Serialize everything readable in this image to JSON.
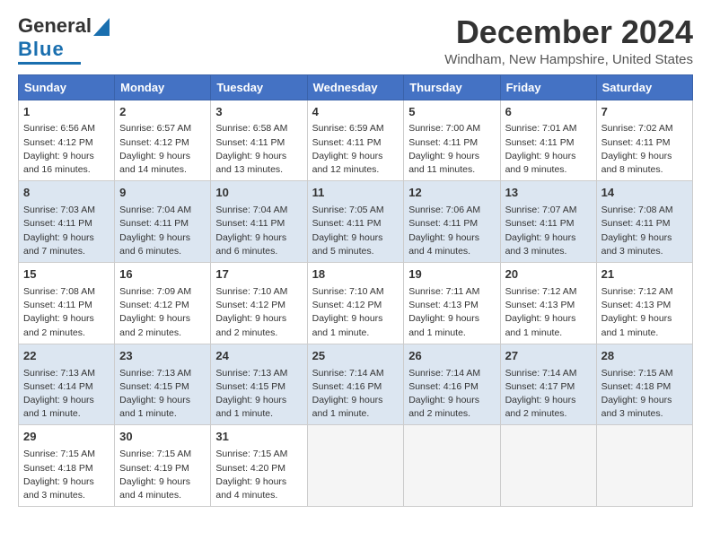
{
  "header": {
    "logo_line1": "General",
    "logo_line2": "Blue",
    "month": "December 2024",
    "location": "Windham, New Hampshire, United States"
  },
  "weekdays": [
    "Sunday",
    "Monday",
    "Tuesday",
    "Wednesday",
    "Thursday",
    "Friday",
    "Saturday"
  ],
  "weeks": [
    [
      {
        "day": 1,
        "info": "Sunrise: 6:56 AM\nSunset: 4:12 PM\nDaylight: 9 hours\nand 16 minutes."
      },
      {
        "day": 2,
        "info": "Sunrise: 6:57 AM\nSunset: 4:12 PM\nDaylight: 9 hours\nand 14 minutes."
      },
      {
        "day": 3,
        "info": "Sunrise: 6:58 AM\nSunset: 4:11 PM\nDaylight: 9 hours\nand 13 minutes."
      },
      {
        "day": 4,
        "info": "Sunrise: 6:59 AM\nSunset: 4:11 PM\nDaylight: 9 hours\nand 12 minutes."
      },
      {
        "day": 5,
        "info": "Sunrise: 7:00 AM\nSunset: 4:11 PM\nDaylight: 9 hours\nand 11 minutes."
      },
      {
        "day": 6,
        "info": "Sunrise: 7:01 AM\nSunset: 4:11 PM\nDaylight: 9 hours\nand 9 minutes."
      },
      {
        "day": 7,
        "info": "Sunrise: 7:02 AM\nSunset: 4:11 PM\nDaylight: 9 hours\nand 8 minutes."
      }
    ],
    [
      {
        "day": 8,
        "info": "Sunrise: 7:03 AM\nSunset: 4:11 PM\nDaylight: 9 hours\nand 7 minutes."
      },
      {
        "day": 9,
        "info": "Sunrise: 7:04 AM\nSunset: 4:11 PM\nDaylight: 9 hours\nand 6 minutes."
      },
      {
        "day": 10,
        "info": "Sunrise: 7:04 AM\nSunset: 4:11 PM\nDaylight: 9 hours\nand 6 minutes."
      },
      {
        "day": 11,
        "info": "Sunrise: 7:05 AM\nSunset: 4:11 PM\nDaylight: 9 hours\nand 5 minutes."
      },
      {
        "day": 12,
        "info": "Sunrise: 7:06 AM\nSunset: 4:11 PM\nDaylight: 9 hours\nand 4 minutes."
      },
      {
        "day": 13,
        "info": "Sunrise: 7:07 AM\nSunset: 4:11 PM\nDaylight: 9 hours\nand 3 minutes."
      },
      {
        "day": 14,
        "info": "Sunrise: 7:08 AM\nSunset: 4:11 PM\nDaylight: 9 hours\nand 3 minutes."
      }
    ],
    [
      {
        "day": 15,
        "info": "Sunrise: 7:08 AM\nSunset: 4:11 PM\nDaylight: 9 hours\nand 2 minutes."
      },
      {
        "day": 16,
        "info": "Sunrise: 7:09 AM\nSunset: 4:12 PM\nDaylight: 9 hours\nand 2 minutes."
      },
      {
        "day": 17,
        "info": "Sunrise: 7:10 AM\nSunset: 4:12 PM\nDaylight: 9 hours\nand 2 minutes."
      },
      {
        "day": 18,
        "info": "Sunrise: 7:10 AM\nSunset: 4:12 PM\nDaylight: 9 hours\nand 1 minute."
      },
      {
        "day": 19,
        "info": "Sunrise: 7:11 AM\nSunset: 4:13 PM\nDaylight: 9 hours\nand 1 minute."
      },
      {
        "day": 20,
        "info": "Sunrise: 7:12 AM\nSunset: 4:13 PM\nDaylight: 9 hours\nand 1 minute."
      },
      {
        "day": 21,
        "info": "Sunrise: 7:12 AM\nSunset: 4:13 PM\nDaylight: 9 hours\nand 1 minute."
      }
    ],
    [
      {
        "day": 22,
        "info": "Sunrise: 7:13 AM\nSunset: 4:14 PM\nDaylight: 9 hours\nand 1 minute."
      },
      {
        "day": 23,
        "info": "Sunrise: 7:13 AM\nSunset: 4:15 PM\nDaylight: 9 hours\nand 1 minute."
      },
      {
        "day": 24,
        "info": "Sunrise: 7:13 AM\nSunset: 4:15 PM\nDaylight: 9 hours\nand 1 minute."
      },
      {
        "day": 25,
        "info": "Sunrise: 7:14 AM\nSunset: 4:16 PM\nDaylight: 9 hours\nand 1 minute."
      },
      {
        "day": 26,
        "info": "Sunrise: 7:14 AM\nSunset: 4:16 PM\nDaylight: 9 hours\nand 2 minutes."
      },
      {
        "day": 27,
        "info": "Sunrise: 7:14 AM\nSunset: 4:17 PM\nDaylight: 9 hours\nand 2 minutes."
      },
      {
        "day": 28,
        "info": "Sunrise: 7:15 AM\nSunset: 4:18 PM\nDaylight: 9 hours\nand 3 minutes."
      }
    ],
    [
      {
        "day": 29,
        "info": "Sunrise: 7:15 AM\nSunset: 4:18 PM\nDaylight: 9 hours\nand 3 minutes."
      },
      {
        "day": 30,
        "info": "Sunrise: 7:15 AM\nSunset: 4:19 PM\nDaylight: 9 hours\nand 4 minutes."
      },
      {
        "day": 31,
        "info": "Sunrise: 7:15 AM\nSunset: 4:20 PM\nDaylight: 9 hours\nand 4 minutes."
      },
      null,
      null,
      null,
      null
    ]
  ]
}
